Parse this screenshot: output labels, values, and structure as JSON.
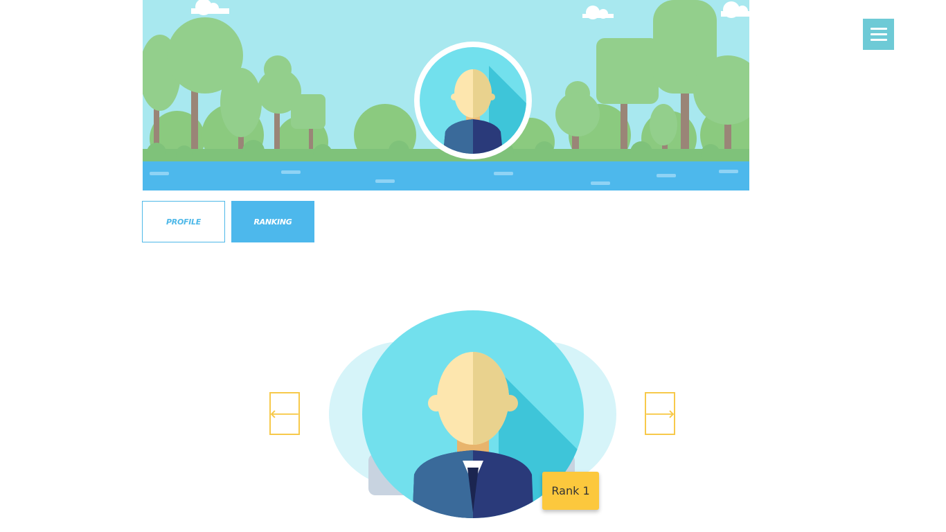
{
  "tabs": [
    {
      "label": "PROFILE",
      "active": false
    },
    {
      "label": "RANKING",
      "active": true
    }
  ],
  "carousel": {
    "prev_icon": "arrow-left-icon",
    "next_icon": "arrow-right-icon",
    "prev_glyph": "🡐",
    "next_glyph": "🡒",
    "badge_label": "Rank 1"
  },
  "menu": {
    "icon": "hamburger-menu-icon"
  },
  "colors": {
    "accent_blue": "#4db8ec",
    "menu_teal": "#6ecad6",
    "rank_yellow": "#fcc83d",
    "arrow_yellow": "#f7c94a",
    "sky": "#a8e8ef",
    "water": "#4db8ec"
  }
}
